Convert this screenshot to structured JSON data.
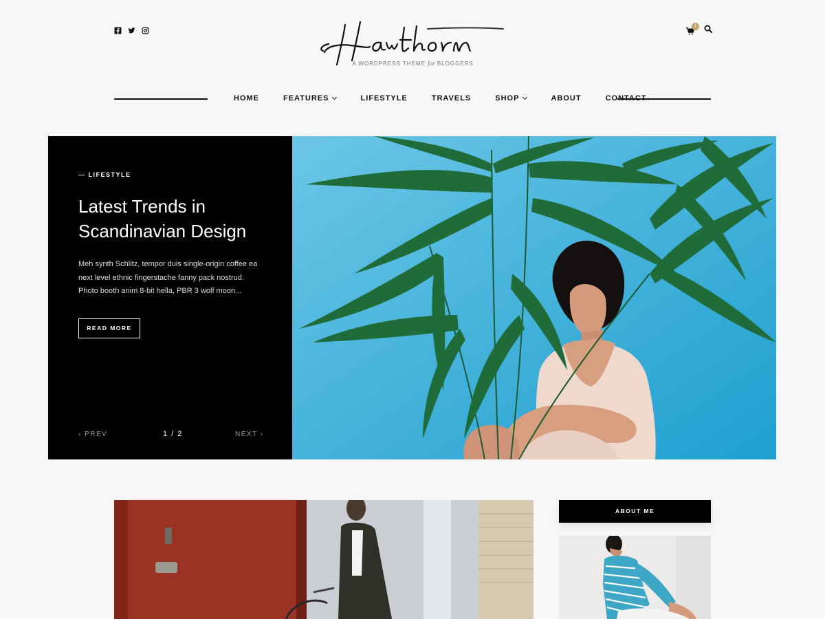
{
  "header": {
    "social_icons": [
      "facebook-icon",
      "twitter-icon",
      "instagram-icon"
    ],
    "brand_logo": "Hawthorn",
    "tagline_pre": "A WORDPRESS THEME",
    "tagline_italic": "for",
    "tagline_post": "BLOGGERS",
    "cart_count": "1",
    "tools": [
      "cart-icon",
      "search-icon"
    ]
  },
  "nav": {
    "items": [
      {
        "label": "HOME",
        "dropdown": false
      },
      {
        "label": "FEATURES",
        "dropdown": true
      },
      {
        "label": "LIFESTYLE",
        "dropdown": false
      },
      {
        "label": "TRAVELS",
        "dropdown": false
      },
      {
        "label": "SHOP",
        "dropdown": true
      },
      {
        "label": "ABOUT",
        "dropdown": false
      },
      {
        "label": "CONTACT",
        "dropdown": false
      }
    ]
  },
  "hero": {
    "category": "— LIFESTYLE",
    "title": "Latest Trends in Scandinavian Design",
    "excerpt": "Meh synth Schlitz, tempor duis single-origin coffee ea next level ethnic fingerstache fanny pack nostrud. Photo booth anim 8-bit hella, PBR 3 wolf moon...",
    "button_label": "READ MORE",
    "prev_label": "‹ PREV",
    "page_indicator": "1 / 2",
    "next_label": "NEXT ›"
  },
  "sidebar": {
    "widget_title": "ABOUT ME"
  },
  "colors": {
    "background": "#f7f7f7",
    "hero_panel": "#000000",
    "hero_sky": "#4fb6d8",
    "cart_badge": "#c5a272",
    "accent_red": "#9a3323"
  }
}
